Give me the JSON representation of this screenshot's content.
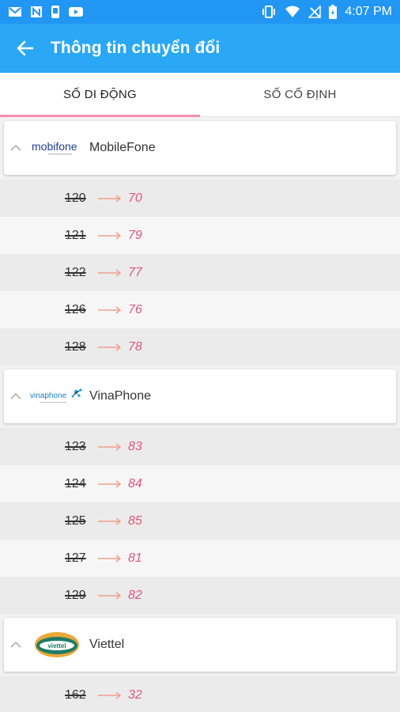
{
  "status_bar": {
    "time": "4:07 PM"
  },
  "app_bar": {
    "title": "Thông tin chuyển đổi"
  },
  "tabs": [
    {
      "label": "SỐ DI ĐỘNG",
      "active": true
    },
    {
      "label": "SỐ CỐ ĐỊNH",
      "active": false
    }
  ],
  "groups": [
    {
      "name": "MobileFone",
      "logo_text": "mobifone",
      "rows": [
        {
          "old": "120",
          "new": "70"
        },
        {
          "old": "121",
          "new": "79"
        },
        {
          "old": "122",
          "new": "77"
        },
        {
          "old": "126",
          "new": "76"
        },
        {
          "old": "128",
          "new": "78"
        }
      ]
    },
    {
      "name": "VinaPhone",
      "logo_text": "vinaphone",
      "rows": [
        {
          "old": "123",
          "new": "83"
        },
        {
          "old": "124",
          "new": "84"
        },
        {
          "old": "125",
          "new": "85"
        },
        {
          "old": "127",
          "new": "81"
        },
        {
          "old": "129",
          "new": "82"
        }
      ]
    },
    {
      "name": "Viettel",
      "logo_text": "viettel",
      "rows": [
        {
          "old": "162",
          "new": "32"
        }
      ]
    }
  ],
  "colors": {
    "app_bar": "#2ba8f5",
    "status_bar": "#2196f3",
    "accent": "#f48fb1",
    "new_prefix": "#e0567f"
  }
}
